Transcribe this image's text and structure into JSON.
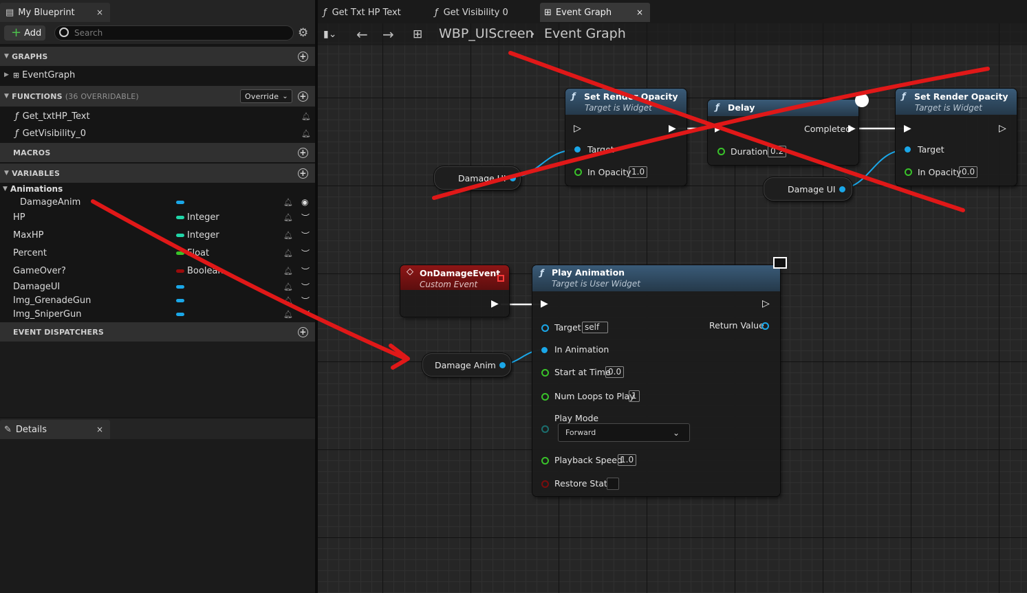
{
  "window_tabs": {
    "my_blueprint": "My Blueprint",
    "details": "Details",
    "close": "×"
  },
  "toolbar": {
    "add_label": "Add",
    "search_placeholder": "Search"
  },
  "sections": {
    "graphs": "GRAPHS",
    "functions": "FUNCTIONS",
    "functions_note": "(36 OVERRIDABLE)",
    "override": "Override",
    "macros": "MACROS",
    "variables": "VARIABLES",
    "event_dispatchers": "EVENT DISPATCHERS"
  },
  "graphs": [
    "EventGraph"
  ],
  "functions": [
    "Get_txtHP_Text",
    "GetVisibility_0"
  ],
  "variables": {
    "category": "Animations",
    "items": [
      {
        "name": "DamageAnim",
        "type": "",
        "color": "#1aa7e8"
      },
      {
        "name": "HP",
        "type": "Integer",
        "color": "#20d6a8"
      },
      {
        "name": "MaxHP",
        "type": "Integer",
        "color": "#20d6a8"
      },
      {
        "name": "Percent",
        "type": "Float",
        "color": "#39c22a"
      },
      {
        "name": "GameOver?",
        "type": "Boolean",
        "color": "#9a0b0b"
      },
      {
        "name": "DamageUI",
        "type": "",
        "color": "#1aa7e8"
      },
      {
        "name": "Img_GrenadeGun",
        "type": "",
        "color": "#1aa7e8"
      },
      {
        "name": "Img_SniperGun",
        "type": "",
        "color": "#1aa7e8"
      }
    ]
  },
  "doc_tabs": [
    {
      "label": "Get Txt HP Text"
    },
    {
      "label": "Get Visibility 0"
    },
    {
      "label": "Event Graph"
    }
  ],
  "breadcrumb": {
    "asset": "WBP_UIScreen",
    "graph": "Event Graph"
  },
  "nodes": {
    "set_opacity_1": {
      "title": "Set Render Opacity",
      "subtitle": "Target is Widget",
      "target": "Target",
      "in_opacity": "In Opacity",
      "opacity_value": "1.0"
    },
    "delay": {
      "title": "Delay",
      "completed": "Completed",
      "duration": "Duration",
      "duration_value": "0.2"
    },
    "set_opacity_2": {
      "title": "Set Render Opacity",
      "subtitle": "Target is Widget",
      "target": "Target",
      "in_opacity": "In Opacity",
      "opacity_value": "0.0"
    },
    "damage_ui_1": "Damage UI",
    "damage_ui_2": "Damage UI",
    "on_damage": {
      "title": "OnDamageEvent",
      "subtitle": "Custom Event"
    },
    "damage_anim": "Damage Anim",
    "play_anim": {
      "title": "Play Animation",
      "subtitle": "Target is User Widget",
      "target": "Target",
      "target_value": "self",
      "return_value": "Return Value",
      "in_animation": "In Animation",
      "start_time": "Start at Time",
      "start_time_value": "0.0",
      "num_loops": "Num Loops to Play",
      "num_loops_value": "1",
      "play_mode": "Play Mode",
      "play_mode_value": "Forward",
      "playback_speed": "Playback Speed",
      "playback_speed_value": "1.0",
      "restore_state": "Restore State"
    }
  },
  "colors": {
    "object_pin": "#1aa7e8",
    "float_pin": "#39c22a",
    "annotation_red": "#e01818",
    "function_header": "#2b4760",
    "event_header": "#7a1313"
  }
}
